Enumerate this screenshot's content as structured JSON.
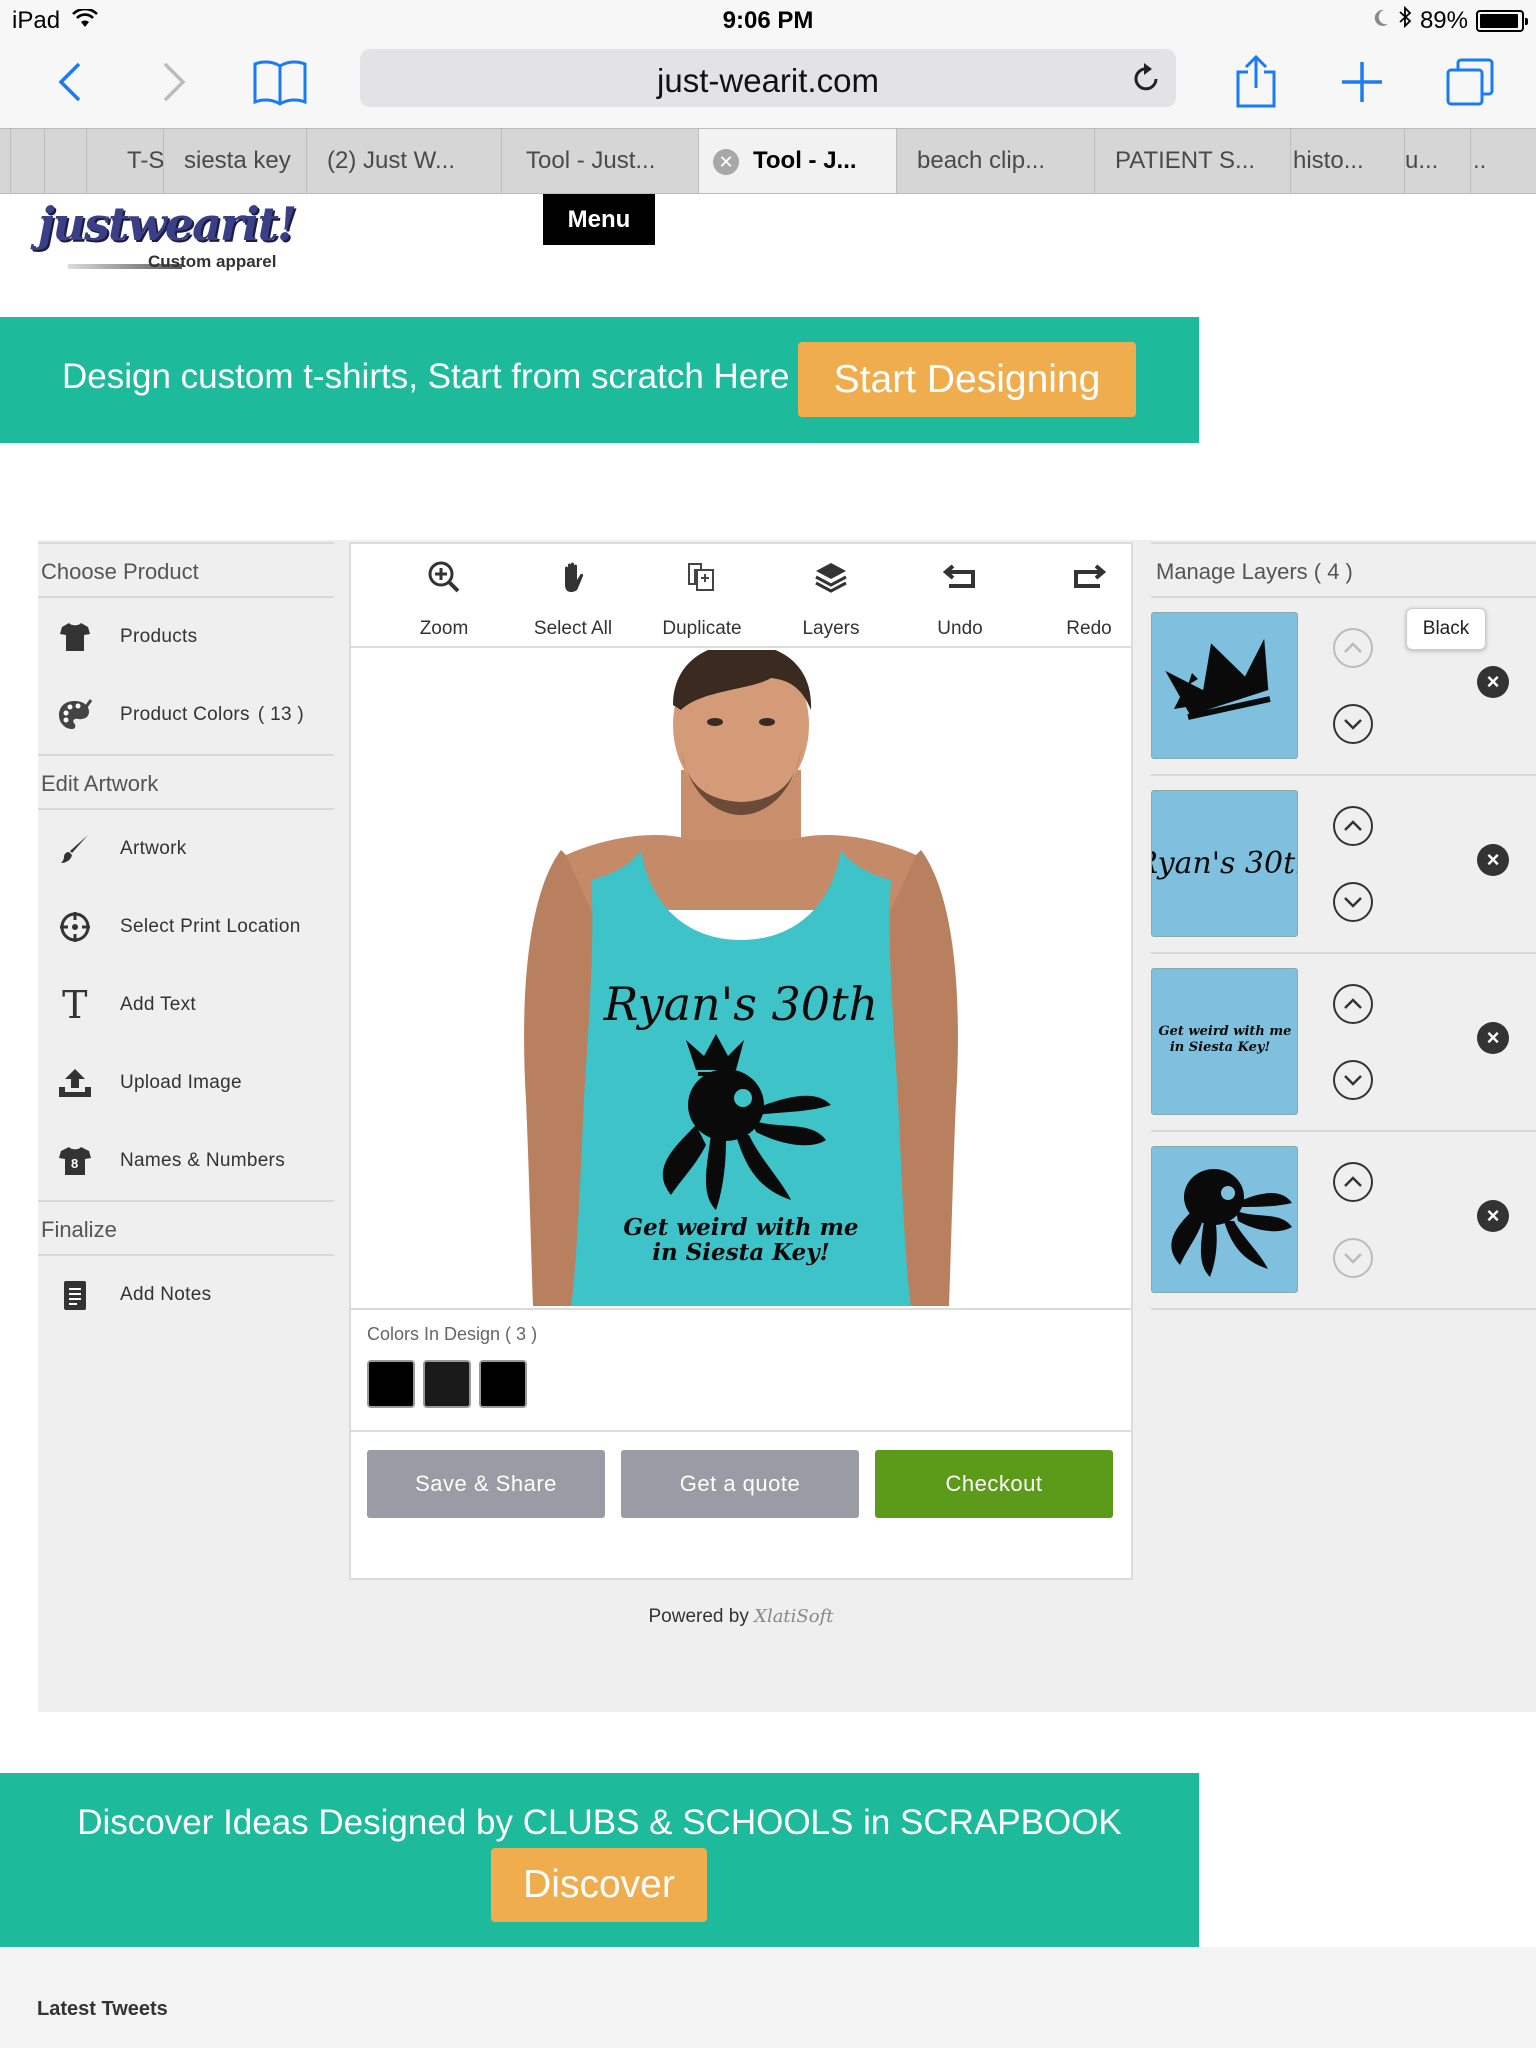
{
  "status_bar": {
    "device": "iPad",
    "time": "9:06 PM",
    "battery": "89%"
  },
  "browser": {
    "url": "just-wearit.com",
    "tabs": [
      {
        "title": "T-S"
      },
      {
        "title": "siesta key"
      },
      {
        "title": "(2) Just W..."
      },
      {
        "title": "Tool - Just..."
      },
      {
        "title": "Tool - J...",
        "active": true
      },
      {
        "title": "beach clip..."
      },
      {
        "title": "PATIENT S..."
      },
      {
        "title": "histo..."
      },
      {
        "title": "u..."
      },
      {
        "title": ".."
      }
    ]
  },
  "site": {
    "logo_text": "justwearit!",
    "logo_tagline": "Custom apparel",
    "menu_label": "Menu"
  },
  "banner_top": {
    "text": "Design custom t-shirts, Start from scratch Here",
    "button": "Start Designing"
  },
  "sidebar": {
    "sections": [
      {
        "title": "Choose Product",
        "items": [
          {
            "label": "Products",
            "icon": "tshirt-icon"
          },
          {
            "label": "Product Colors",
            "count": "( 13 )",
            "icon": "palette-icon"
          }
        ]
      },
      {
        "title": "Edit Artwork",
        "items": [
          {
            "label": "Artwork",
            "icon": "brush-icon"
          },
          {
            "label": "Select Print Location",
            "icon": "crosshair-icon"
          },
          {
            "label": "Add Text",
            "icon": "text-icon"
          },
          {
            "label": "Upload Image",
            "icon": "upload-icon"
          },
          {
            "label": "Names & Numbers",
            "icon": "jersey-icon"
          }
        ]
      },
      {
        "title": "Finalize",
        "items": [
          {
            "label": "Add Notes",
            "icon": "notes-icon"
          }
        ]
      }
    ]
  },
  "toolbar": {
    "zoom": "Zoom",
    "select_all": "Select All",
    "duplicate": "Duplicate",
    "layers": "Layers",
    "undo": "Undo",
    "redo": "Redo"
  },
  "canvas": {
    "design_line1": "Ryan's 30th",
    "design_line2": "Get weird with me",
    "design_line3": "in Siesta Key!",
    "shirt_color": "#3ec3c9"
  },
  "colors_in_design": {
    "title": "Colors In Design ( 3 )",
    "swatches": [
      "#000000",
      "#1a1a1a",
      "#000000"
    ]
  },
  "actions": {
    "save_share": "Save & Share",
    "get_quote": "Get a quote",
    "checkout": "Checkout"
  },
  "powered_by": {
    "label": "Powered by",
    "brand": "XlatiSoft"
  },
  "layers_panel": {
    "title": "Manage Layers ( 4 )",
    "tooltip": "Black",
    "layers": [
      {
        "name": "crown",
        "icon": "crown-icon"
      },
      {
        "name": "text-ryans-30th",
        "text": "Ryan's 30th"
      },
      {
        "name": "text-get-weird",
        "text1": "Get weird with me",
        "text2": "in Siesta Key!"
      },
      {
        "name": "octopus",
        "icon": "octopus-icon"
      }
    ]
  },
  "banner_bottom": {
    "text": "Discover Ideas Designed by CLUBS & SCHOOLS in SCRAPBOOK",
    "button": "Discover"
  },
  "footer": {
    "latest_tweets": "Latest Tweets"
  },
  "colors": {
    "accent_teal": "#1dba9b",
    "orange": "#f0ad4e",
    "checkout_green": "#5c9a1a",
    "gray_button": "#9a9ca5",
    "ios_blue": "#1a7cf5"
  }
}
